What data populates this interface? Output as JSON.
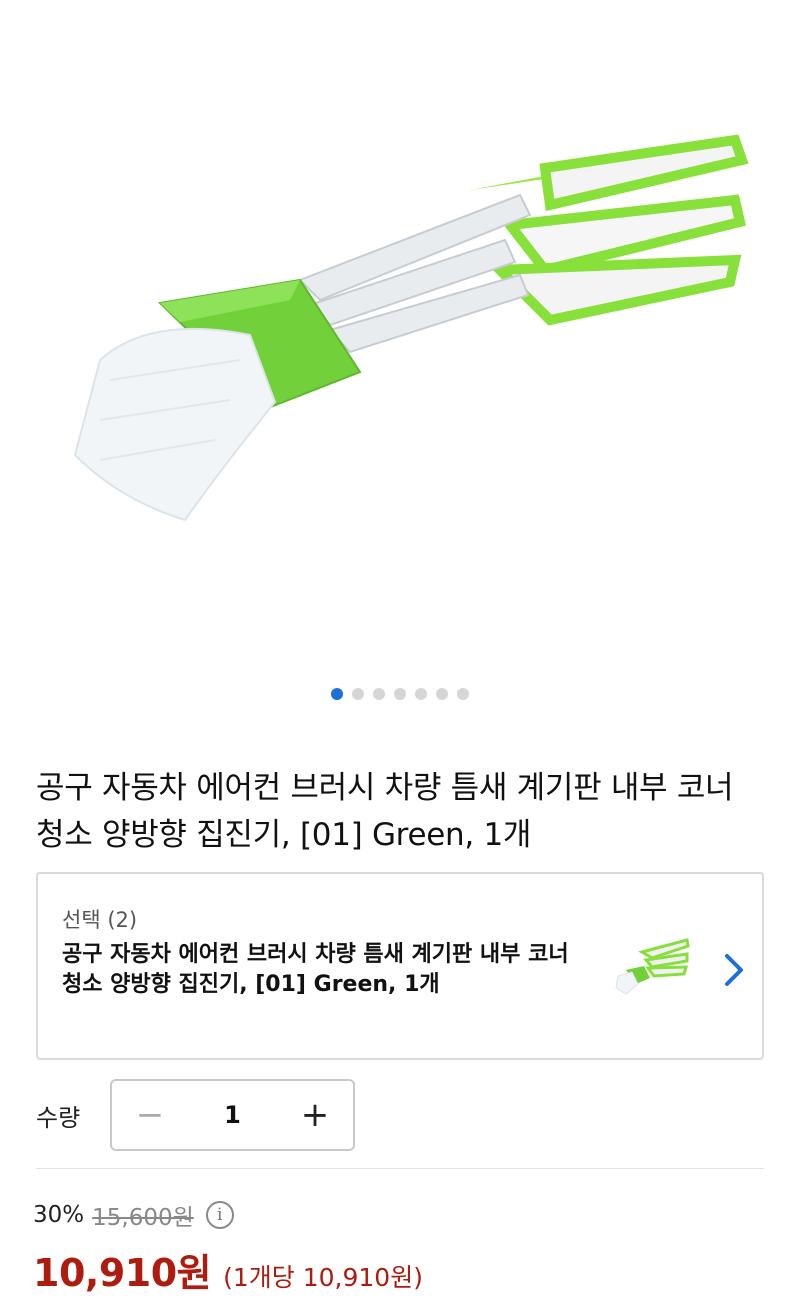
{
  "gallery": {
    "image_alt": "",
    "image_count": 7,
    "active_index": 0
  },
  "product": {
    "title": "공구 자동차 에어컨 브러시 차량 틈새 계기판 내부 코너 청소 양방향 집진기, [01] Green, 1개"
  },
  "option": {
    "label": "선택 (2)",
    "name": "공구 자동차 에어컨 브러시 차량 틈새 계기판 내부 코너 청소 양방향 집진기, [01] Green, 1개",
    "chevron_icon": "chevron-right-icon"
  },
  "quantity": {
    "label": "수량",
    "value": "1",
    "minus": "−",
    "plus": "+"
  },
  "price": {
    "discount_rate": "30%",
    "original": "15,600원",
    "info_symbol": "i",
    "sale": "10,910원",
    "unit": "(1개당 10,910원)"
  },
  "colors": {
    "accent": "#1e6fd9",
    "price": "#ad1c0e",
    "brush_green": "#7ed321"
  }
}
